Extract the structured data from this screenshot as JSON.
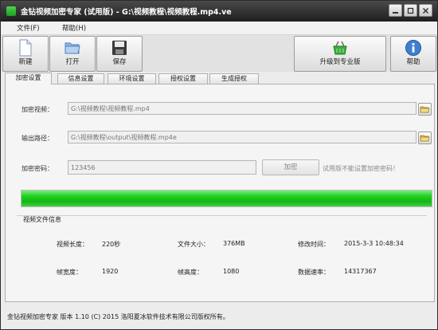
{
  "window": {
    "title": "金钻视频加密专家 (试用版) - G:\\视频教程\\视频教程.mp4.ve"
  },
  "menu": {
    "items": [
      {
        "label": "文件(F)"
      },
      {
        "label": "帮助(H)"
      }
    ]
  },
  "toolbar": {
    "new_label": "新建",
    "open_label": "打开",
    "save_label": "保存",
    "upgrade_label": "升级到专业版",
    "help_label": "帮助"
  },
  "tabs": [
    {
      "label": "加密设置",
      "active": true
    },
    {
      "label": "信息设置",
      "active": false
    },
    {
      "label": "环境设置",
      "active": false
    },
    {
      "label": "授权设置",
      "active": false
    },
    {
      "label": "生成授权",
      "active": false
    }
  ],
  "form": {
    "video_label": "加密视频：",
    "video_value": "G:\\视频教程\\视频教程.mp4",
    "output_label": "输出路径：",
    "output_value": "G:\\视频教程\\output\\视频教程.mp4e",
    "password_label": "加密密码：",
    "password_value": "123456",
    "encrypt_button": "加密",
    "password_hint": "试用版不能设置加密密码！"
  },
  "progress": {
    "percent": 100
  },
  "info": {
    "title": "视频文件信息",
    "fields": [
      {
        "label": "视频长度：",
        "value": "220秒"
      },
      {
        "label": "文件大小：",
        "value": "376MB"
      },
      {
        "label": "修改时间：",
        "value": "2015-3-3 10:48:34"
      },
      {
        "label": "帧宽度：",
        "value": "1920"
      },
      {
        "label": "帧高度：",
        "value": "1080"
      },
      {
        "label": "数据速率：",
        "value": "14317367"
      }
    ]
  },
  "status": {
    "text": "金钻视频加密专家  版本 1.10 (C)  2015 洛阳夏冰软件技术有限公司版权所有。"
  },
  "colors": {
    "progress_fill": "#22d022",
    "titlebar": "#2a2a2a"
  }
}
